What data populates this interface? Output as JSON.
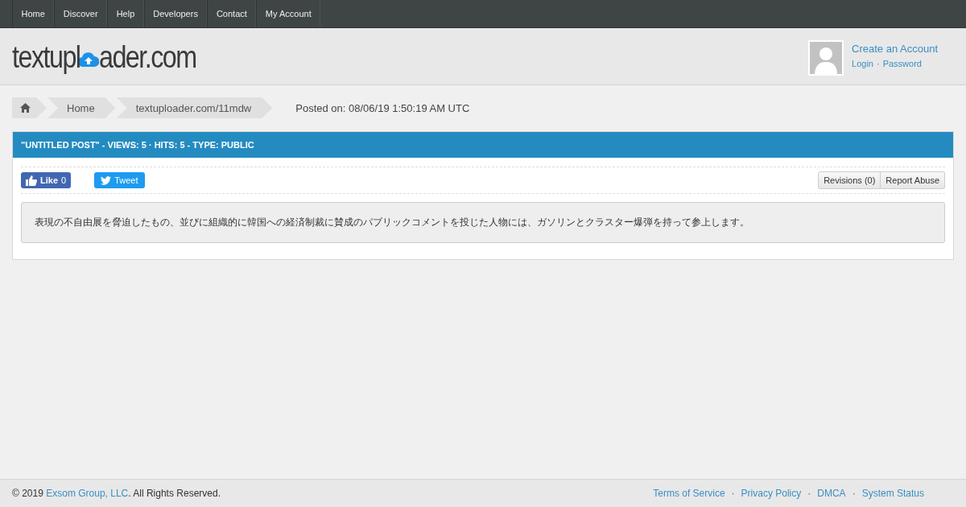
{
  "nav": {
    "items": [
      {
        "label": "Home"
      },
      {
        "label": "Discover"
      },
      {
        "label": "Help"
      },
      {
        "label": "Developers"
      },
      {
        "label": "Contact"
      },
      {
        "label": "My Account"
      }
    ]
  },
  "logo": {
    "before": "textupl",
    "after": "ader.com"
  },
  "account": {
    "create": "Create an Account",
    "login": "Login",
    "separator": "·",
    "password": "Password"
  },
  "breadcrumb": {
    "items": [
      {
        "kind": "home"
      },
      {
        "kind": "text",
        "label": "Home"
      },
      {
        "kind": "text",
        "label": "textuploader.com/11mdw"
      }
    ],
    "posted": "Posted on: 08/06/19 1:50:19 AM UTC"
  },
  "post": {
    "title": "\"UNTITLED POST\" - VIEWS: 5 · HITS: 5 - TYPE: PUBLIC",
    "like": {
      "label": "Like",
      "count": "0"
    },
    "tweet": "Tweet",
    "actions": [
      "Revisions (0)",
      "Report Abuse"
    ],
    "content": "表現の不自由展を脅迫したもの、並びに組織的に韓国への経済制裁に賛成のパブリックコメントを投じた人物には、ガソリンとクラスター爆弾を持って参上します。"
  },
  "footer": {
    "copyright": "© 2019",
    "company": "Exsom Group, LLC",
    "rights": ". All Rights Reserved.",
    "separator": "·",
    "links": [
      "Terms of Service",
      "Privacy Policy",
      "DMCA",
      "System Status"
    ]
  }
}
